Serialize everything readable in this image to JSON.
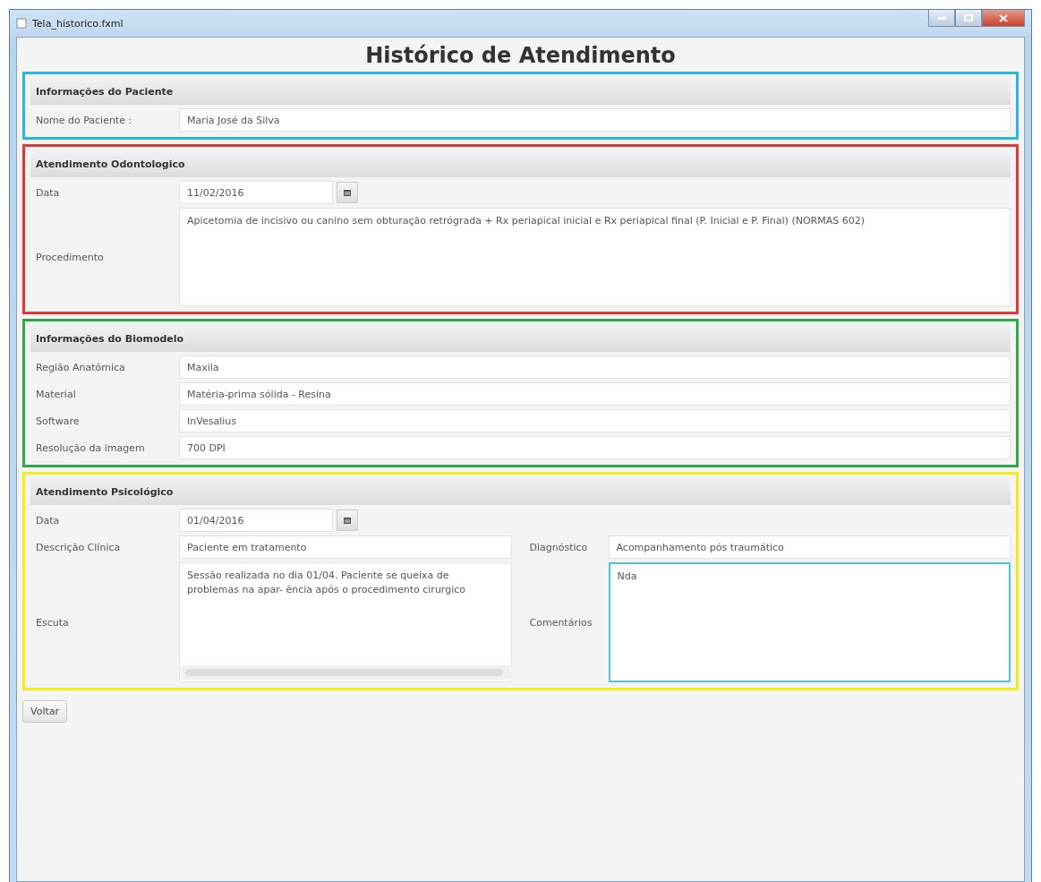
{
  "window": {
    "title": "Tela_historico.fxml"
  },
  "heading": "Histórico de Atendimento",
  "sections": [
    {
      "title": "Informações do Paciente",
      "color": "#2ab5d9",
      "rows": [
        [
          {
            "kind": "text",
            "label": "Nome do Paciente :",
            "value": "Maria José da Silva",
            "focused": false
          }
        ]
      ]
    },
    {
      "title": "Atendimento Odontologico",
      "color": "#e0393a",
      "rows": [
        [
          {
            "kind": "date",
            "label": "Data",
            "value": "11/02/2016",
            "focused": false
          }
        ],
        [
          {
            "kind": "textarea",
            "label": "Procedimento",
            "value": "Apicetomia de incisivo ou canino sem obturação retrógrada + Rx periapical inicial e Rx periapical final (P. Inicial e P. Final) (NORMAS 602)",
            "focused": false
          }
        ]
      ]
    },
    {
      "title": "Informações do Biomodelo",
      "color": "#2ea84a",
      "rows": [
        [
          {
            "kind": "text",
            "label": "Região Anatômica",
            "value": "Maxila",
            "focused": false
          }
        ],
        [
          {
            "kind": "text",
            "label": "Material",
            "value": "Matéria-prima sólida - Resina",
            "focused": false
          }
        ],
        [
          {
            "kind": "text",
            "label": "Software",
            "value": "InVesalius",
            "focused": false
          }
        ],
        [
          {
            "kind": "text",
            "label": "Resolução da imagem",
            "value": "700 DPI",
            "focused": false
          }
        ]
      ]
    },
    {
      "title": "Atendimento Psicológico",
      "color": "#f5ee14",
      "rows": [
        [
          {
            "kind": "date",
            "label": "Data",
            "value": "01/04/2016",
            "focused": false
          }
        ],
        [
          {
            "kind": "text",
            "label": "Descrição Clínica",
            "value": "Paciente em tratamento",
            "focused": false
          },
          {
            "kind": "text",
            "label": "Diagnóstico",
            "value": "Acompanhamento pós traumático",
            "focused": false
          }
        ],
        [
          {
            "kind": "scrollarea",
            "label": "Escuta",
            "value": "Sessão realizada no dia 01/04. Paciente se queixa de problemas na apar- ência após o procedimento cirurgico",
            "focused": false
          },
          {
            "kind": "textarea",
            "label": "Comentários",
            "value": "Nda",
            "focused": true
          }
        ]
      ]
    }
  ],
  "buttons": [
    {
      "label": "Voltar"
    }
  ]
}
